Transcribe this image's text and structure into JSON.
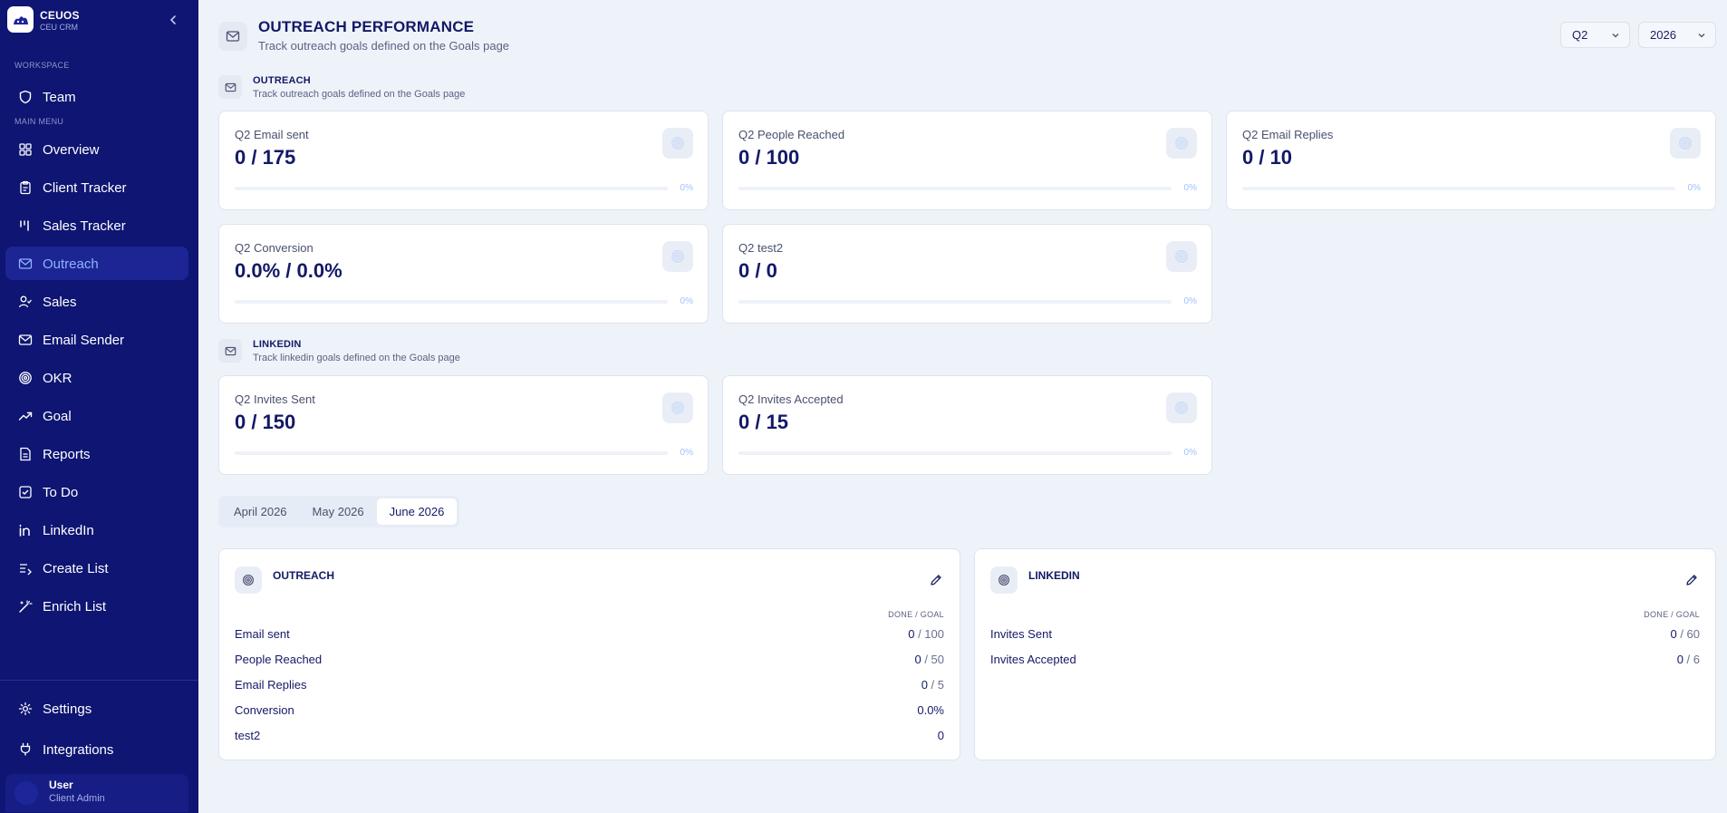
{
  "brand": {
    "name": "CEUOS",
    "sub": "CEU CRM"
  },
  "sidebar": {
    "workspace_label": "WORKSPACE",
    "team_label": "Team",
    "main_menu_label": "MAIN MENU",
    "items": [
      {
        "label": "Overview",
        "icon": "grid-icon"
      },
      {
        "label": "Client Tracker",
        "icon": "clipboard-icon"
      },
      {
        "label": "Sales Tracker",
        "icon": "bars-icon"
      },
      {
        "label": "Outreach",
        "icon": "mail-icon",
        "active": true
      },
      {
        "label": "Sales",
        "icon": "user-check-icon"
      },
      {
        "label": "Email Sender",
        "icon": "mail-icon"
      },
      {
        "label": "OKR",
        "icon": "target-icon"
      },
      {
        "label": "Goal",
        "icon": "trend-icon"
      },
      {
        "label": "Reports",
        "icon": "file-icon"
      },
      {
        "label": "To Do",
        "icon": "checkbox-icon"
      },
      {
        "label": "LinkedIn",
        "icon": "linkedin-icon"
      },
      {
        "label": "Create List",
        "icon": "list-plus-icon"
      },
      {
        "label": "Enrich List",
        "icon": "wand-icon"
      }
    ],
    "settings_label": "Settings",
    "integrations_label": "Integrations",
    "user": {
      "name": "User",
      "role": "Client Admin"
    }
  },
  "header": {
    "title": "OUTREACH PERFORMANCE",
    "subtitle": "Track outreach goals defined on the Goals page",
    "quarter": "Q2",
    "year": "2026"
  },
  "outreach_section": {
    "title": "OUTREACH",
    "subtitle": "Track outreach goals defined on the Goals page",
    "cards": [
      {
        "label": "Q2 Email sent",
        "value": "0 / 175",
        "pct": "0%",
        "progress": 0
      },
      {
        "label": "Q2 People Reached",
        "value": "0 / 100",
        "pct": "0%",
        "progress": 0
      },
      {
        "label": "Q2 Email Replies",
        "value": "0 / 10",
        "pct": "0%",
        "progress": 0
      },
      {
        "label": "Q2 Conversion",
        "value": "0.0% / 0.0%",
        "pct": "0%",
        "progress": 0
      },
      {
        "label": "Q2 test2",
        "value": "0 / 0",
        "pct": "0%",
        "progress": 0
      }
    ]
  },
  "linkedin_section": {
    "title": "LINKEDIN",
    "subtitle": "Track linkedin goals defined on the Goals page",
    "cards": [
      {
        "label": "Q2 Invites Sent",
        "value": "0 / 150",
        "pct": "0%",
        "progress": 0
      },
      {
        "label": "Q2 Invites Accepted",
        "value": "0 / 15",
        "pct": "0%",
        "progress": 0
      }
    ]
  },
  "month_tabs": [
    "April 2026",
    "May 2026",
    "June 2026"
  ],
  "active_month": "June 2026",
  "monthly": {
    "col_header": "DONE / GOAL",
    "outreach": {
      "title": "OUTREACH",
      "rows": [
        {
          "name": "Email sent",
          "done": "0",
          "goal": " / 100"
        },
        {
          "name": "People Reached",
          "done": "0",
          "goal": " / 50"
        },
        {
          "name": "Email Replies",
          "done": "0",
          "goal": " / 5"
        },
        {
          "name": "Conversion",
          "done": "0.0%",
          "goal": ""
        },
        {
          "name": "test2",
          "done": "0",
          "goal": ""
        }
      ]
    },
    "linkedin": {
      "title": "LINKEDIN",
      "rows": [
        {
          "name": "Invites Sent",
          "done": "0",
          "goal": " / 60"
        },
        {
          "name": "Invites Accepted",
          "done": "0",
          "goal": " / 6"
        }
      ]
    }
  },
  "colors": {
    "sidebar_bg": "#0e1572",
    "accent": "#8fb4ff",
    "page_bg": "#eef3fa"
  }
}
